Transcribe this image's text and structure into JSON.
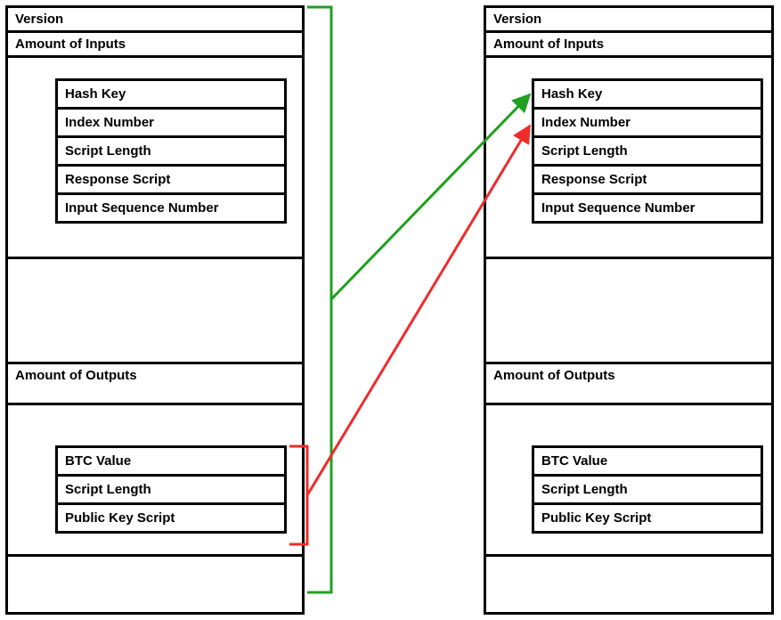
{
  "diagram": {
    "left_block": {
      "version": "Version",
      "amount_inputs": "Amount of Inputs",
      "input_fields": {
        "hash_key": "Hash Key",
        "index_number": "Index Number",
        "script_length": "Script Length",
        "response_script": "Response Script",
        "input_sequence_number": "Input Sequence Number"
      },
      "amount_outputs": "Amount of Outputs",
      "output_fields": {
        "btc_value": "BTC Value",
        "script_length": "Script Length",
        "public_key_script": "Public Key Script"
      }
    },
    "right_block": {
      "version": "Version",
      "amount_inputs": "Amount of Inputs",
      "input_fields": {
        "hash_key": "Hash Key",
        "index_number": "Index Number",
        "script_length": "Script Length",
        "response_script": "Response Script",
        "input_sequence_number": "Input Sequence Number"
      },
      "amount_outputs": "Amount of Outputs",
      "output_fields": {
        "btc_value": "BTC Value",
        "script_length": "Script Length",
        "public_key_script": "Public Key Script"
      }
    },
    "arrows": {
      "green": {
        "color": "#1fa01f",
        "from": "left_block_outline",
        "to": "right_block.input_fields.hash_key"
      },
      "red": {
        "color": "#ef2b2b",
        "from": "left_block.output_fields_group",
        "to": "right_block.input_fields.index_number"
      }
    }
  }
}
